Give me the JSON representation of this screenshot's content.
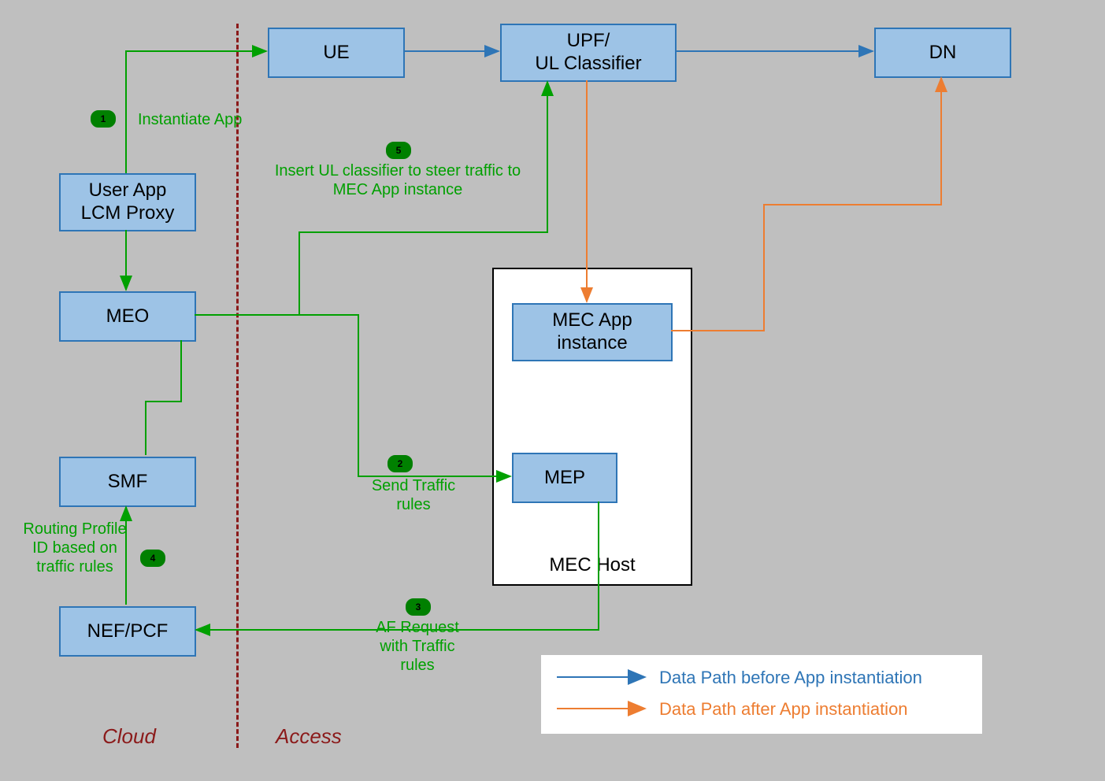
{
  "nodes": {
    "ue": "UE",
    "upf": "UPF/\nUL Classifier",
    "dn": "DN",
    "userapp": "User App\nLCM Proxy",
    "meo": "MEO",
    "smf": "SMF",
    "nefpcf": "NEF/PCF",
    "mecapp": "MEC App\ninstance",
    "mep": "MEP",
    "mechost": "MEC Host"
  },
  "steps": {
    "s1": {
      "num": "1",
      "label": "Instantiate App"
    },
    "s2": {
      "num": "2",
      "label": "Send Traffic\nrules"
    },
    "s3": {
      "num": "3",
      "label": "AF Request\nwith Traffic\nrules"
    },
    "s4": {
      "num": "4",
      "label": "Routing Profile\nID based on\ntraffic rules"
    },
    "s5": {
      "num": "5",
      "label": "Insert UL classifier to steer traffic to\nMEC App instance"
    }
  },
  "regions": {
    "cloud": "Cloud",
    "access": "Access"
  },
  "legend": {
    "before": "Data Path before App instantiation",
    "after": "Data Path after App instantiation"
  },
  "colors": {
    "blue_arrow": "#2e75b6",
    "orange_arrow": "#ed7d31",
    "green_arrow": "#00a000",
    "box_fill": "#9dc3e6",
    "box_border": "#2e75b6",
    "red": "#8b1a1a",
    "badge": "#008000"
  }
}
